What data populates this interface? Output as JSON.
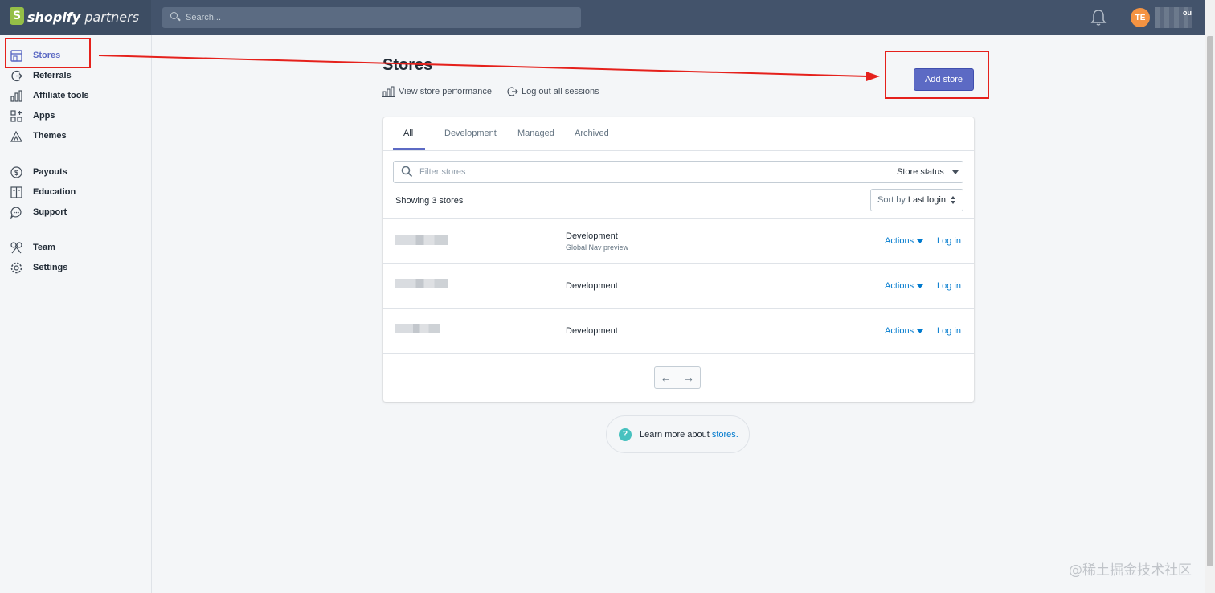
{
  "brand": {
    "name_bold": "shopify",
    "name_light": " partners",
    "bag_letter": "S"
  },
  "search": {
    "placeholder": "Search..."
  },
  "account": {
    "avatar_initials": "TE",
    "name_suffix": "ou"
  },
  "sidebar": {
    "items": [
      {
        "label": "Stores",
        "icon": "store-icon"
      },
      {
        "label": "Referrals",
        "icon": "referrals-icon"
      },
      {
        "label": "Affiliate tools",
        "icon": "chart-icon"
      },
      {
        "label": "Apps",
        "icon": "apps-icon"
      },
      {
        "label": "Themes",
        "icon": "themes-icon"
      },
      {
        "label": "Payouts",
        "icon": "dollar-icon"
      },
      {
        "label": "Education",
        "icon": "book-icon"
      },
      {
        "label": "Support",
        "icon": "chat-icon"
      },
      {
        "label": "Team",
        "icon": "team-icon"
      },
      {
        "label": "Settings",
        "icon": "gear-icon"
      }
    ],
    "active": "Stores"
  },
  "page": {
    "title": "Stores",
    "view_performance": "View store performance",
    "logout_sessions": "Log out all sessions",
    "add_store": "Add store"
  },
  "tabs": [
    "All",
    "Development",
    "Managed",
    "Archived"
  ],
  "filter": {
    "placeholder": "Filter stores",
    "status_label": "Store status"
  },
  "list": {
    "showing": "Showing 3 stores",
    "sort_prefix": "Sort by",
    "sort_value": "Last login",
    "rows": [
      {
        "type": "Development",
        "subtitle": "Global Nav preview",
        "actions": "Actions",
        "login": "Log in"
      },
      {
        "type": "Development",
        "subtitle": "",
        "actions": "Actions",
        "login": "Log in"
      },
      {
        "type": "Development",
        "subtitle": "",
        "actions": "Actions",
        "login": "Log in"
      }
    ]
  },
  "pager": {
    "prev": "←",
    "next": "→"
  },
  "help": {
    "icon": "?",
    "text": "Learn more about",
    "link": "stores."
  },
  "watermark": "@稀土掘金技术社区",
  "colors": {
    "accent": "#5c6ac4",
    "link": "#007ace",
    "annotation": "#e5211c",
    "topbar": "#43536b"
  }
}
